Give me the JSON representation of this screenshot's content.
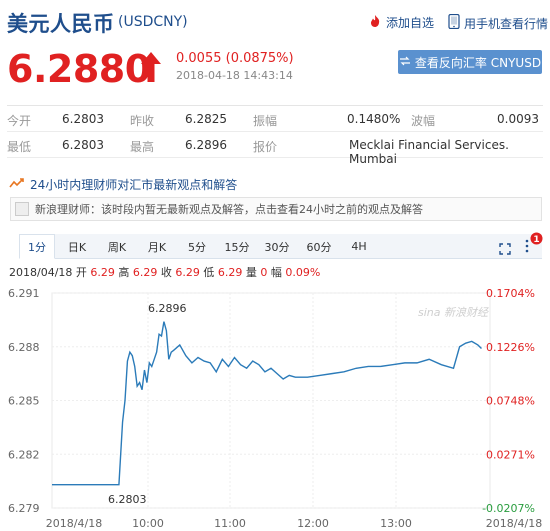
{
  "header": {
    "title": "美元人民币",
    "code": "(USDCNY)",
    "fav_label": "添加自选",
    "mobile_label": "用手机查看行情"
  },
  "quote": {
    "price": "6.2880",
    "change": "0.0055 (0.0875%)",
    "time": "2018-04-18 14:43:14",
    "reverse_label": "查看反向汇率 CNYUSD"
  },
  "stats": [
    [
      {
        "l": "今开",
        "v": "6.2803"
      },
      {
        "l": "昨收",
        "v": "6.2825"
      },
      {
        "l": "振幅",
        "v": "0.1480%"
      },
      {
        "l": "波幅",
        "v": "0.0093"
      }
    ],
    [
      {
        "l": "最低",
        "v": "6.2803"
      },
      {
        "l": "最高",
        "v": "6.2896"
      },
      {
        "l": "报价",
        "v": "Mecklai Financial Services. Mumbai"
      }
    ]
  ],
  "commentary": {
    "title": "24小时内理财师对汇市最新观点和解答",
    "text": "新浪理财师：该时段内暂无最新观点及解答，点击查看24小时之前的观点及解答"
  },
  "tabs": [
    "1分",
    "日K",
    "周K",
    "月K",
    "5分",
    "15分",
    "30分",
    "60分",
    "4H"
  ],
  "active_tab": "1分",
  "infoline": {
    "date": "2018/04/18",
    "open_l": "开",
    "open_v": "6.29",
    "high_l": "高",
    "high_v": "6.29",
    "close_l": "收",
    "close_v": "6.29",
    "low_l": "低",
    "low_v": "6.29",
    "vol_l": "量",
    "vol_v": "0",
    "amp_l": "幅",
    "amp_v": "0.09%"
  },
  "badge": "1",
  "chart_data": {
    "type": "line",
    "title": "",
    "xlabel": "",
    "ylabel": "",
    "x_ticks": [
      "2018/4/18",
      "10:00",
      "11:00",
      "12:00",
      "13:00",
      "2018/4/18"
    ],
    "y_ticks": [
      "6.291",
      "6.288",
      "6.285",
      "6.282",
      "6.279"
    ],
    "y_ticks_right": [
      "0.1704%",
      "0.1226%",
      "0.0748%",
      "0.0271%",
      "-0.0207%"
    ],
    "ylim": [
      6.279,
      6.291
    ],
    "annotations": [
      {
        "label": "6.2896"
      },
      {
        "label": "6.2803"
      }
    ],
    "watermark": "sina 新浪财经",
    "series": [
      {
        "values": [
          [
            0,
            6.2803
          ],
          [
            0.1,
            6.2803
          ],
          [
            0.2,
            6.2803
          ],
          [
            0.3,
            6.2803
          ],
          [
            0.4,
            6.2803
          ],
          [
            0.5,
            6.2803
          ],
          [
            0.55,
            6.2803
          ],
          [
            0.58,
            6.2838
          ],
          [
            0.6,
            6.285
          ],
          [
            0.62,
            6.2872
          ],
          [
            0.64,
            6.2877
          ],
          [
            0.66,
            6.2875
          ],
          [
            0.68,
            6.2869
          ],
          [
            0.7,
            6.2858
          ],
          [
            0.72,
            6.286
          ],
          [
            0.74,
            6.2856
          ],
          [
            0.76,
            6.2867
          ],
          [
            0.78,
            6.286
          ],
          [
            0.8,
            6.2871
          ],
          [
            0.82,
            6.2869
          ],
          [
            0.84,
            6.2873
          ],
          [
            0.86,
            6.2877
          ],
          [
            0.88,
            6.2887
          ],
          [
            0.9,
            6.2886
          ],
          [
            0.92,
            6.2894
          ],
          [
            0.94,
            6.2889
          ],
          [
            0.96,
            6.2873
          ],
          [
            0.98,
            6.2877
          ],
          [
            1.0,
            6.2878
          ],
          [
            1.05,
            6.2881
          ],
          [
            1.1,
            6.2875
          ],
          [
            1.15,
            6.2871
          ],
          [
            1.2,
            6.2874
          ],
          [
            1.25,
            6.2872
          ],
          [
            1.3,
            6.2871
          ],
          [
            1.35,
            6.2866
          ],
          [
            1.4,
            6.2873
          ],
          [
            1.45,
            6.2869
          ],
          [
            1.5,
            6.2874
          ],
          [
            1.55,
            6.287
          ],
          [
            1.6,
            6.2868
          ],
          [
            1.65,
            6.2872
          ],
          [
            1.7,
            6.287
          ],
          [
            1.75,
            6.2866
          ],
          [
            1.8,
            6.2868
          ],
          [
            1.85,
            6.2865
          ],
          [
            1.9,
            6.2862
          ],
          [
            1.95,
            6.2864
          ],
          [
            2.0,
            6.2863
          ],
          [
            2.1,
            6.2863
          ],
          [
            2.2,
            6.2864
          ],
          [
            2.3,
            6.2865
          ],
          [
            2.4,
            6.2866
          ],
          [
            2.5,
            6.2868
          ],
          [
            2.6,
            6.2869
          ],
          [
            2.7,
            6.2869
          ],
          [
            2.8,
            6.287
          ],
          [
            2.9,
            6.2871
          ],
          [
            3.0,
            6.2871
          ],
          [
            3.1,
            6.2873
          ],
          [
            3.2,
            6.287
          ],
          [
            3.3,
            6.2868
          ],
          [
            3.35,
            6.288
          ],
          [
            3.4,
            6.2882
          ],
          [
            3.45,
            6.2883
          ],
          [
            3.5,
            6.2881
          ],
          [
            3.53,
            6.2879
          ]
        ]
      }
    ]
  }
}
